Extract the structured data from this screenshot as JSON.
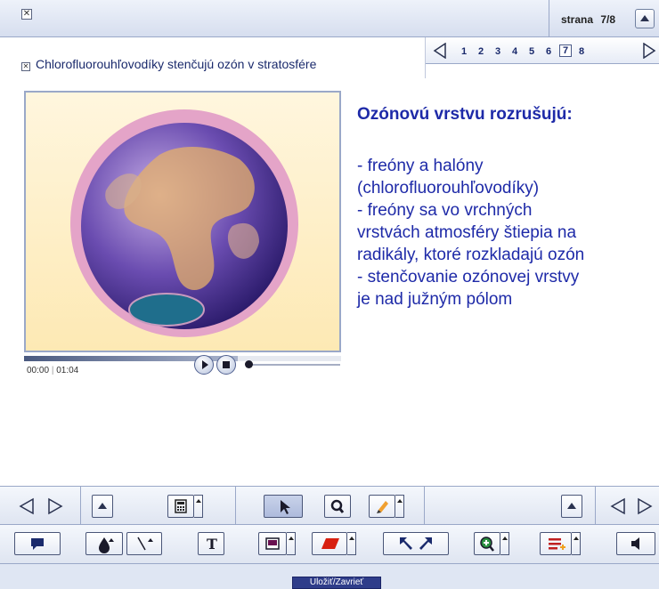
{
  "header": {
    "page_label": "strana",
    "page_value": "7/8"
  },
  "slide": {
    "title": "Chlorofluorouhľovodíky stenčujú ozón v stratosfére"
  },
  "pagenav": {
    "pages": [
      "1",
      "2",
      "3",
      "4",
      "5",
      "6",
      "7",
      "8"
    ],
    "current": "7"
  },
  "video": {
    "time_current": "00:00",
    "time_separator": "|",
    "time_total": "01:04"
  },
  "text": {
    "heading": "Ozónovú vrstvu rozrušujú:",
    "lines": [
      "- freóny a halóny",
      "(chlorofluorouhľovodíky)",
      "- freóny sa vo vrchných",
      "vrstvách atmosféry štiepia na",
      "radikály, ktoré rozkladajú ozón",
      "- stenčovanie ozónovej vrstvy",
      "je nad južným pólom"
    ]
  },
  "footer": {
    "save_label": "Uložiť/Zavrieť"
  },
  "colors": {
    "accent_text": "#1e2aa8",
    "toolbar_bg": "#dfe5f1",
    "save_button": "#2f3d8a"
  },
  "icons": [
    "close-icon",
    "arrow-up-icon",
    "arrow-left-icon",
    "arrow-right-icon",
    "calculator-icon",
    "cursor-icon",
    "magnifier-icon",
    "pencil-icon",
    "comment-icon",
    "ink-drop-icon",
    "line-icon",
    "text-tool-icon",
    "fill-color-icon",
    "shape-icon",
    "undo-icon",
    "redo-icon",
    "zoom-in-icon",
    "list-add-icon",
    "speaker-icon",
    "play-icon",
    "stop-icon"
  ]
}
